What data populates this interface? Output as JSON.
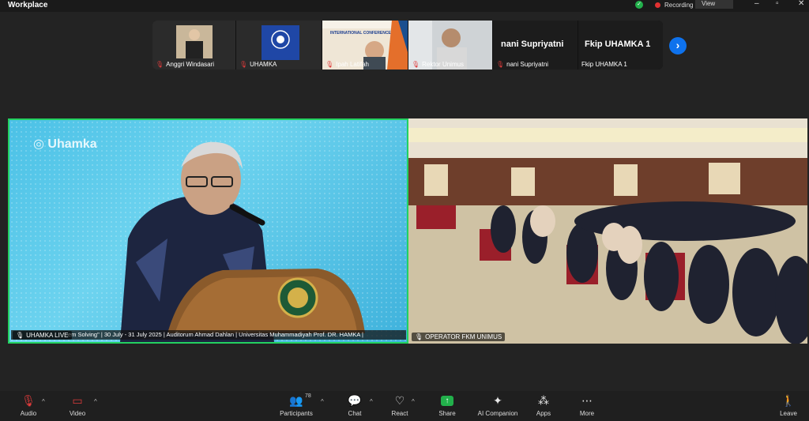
{
  "app": {
    "title": "Workplace"
  },
  "status": {
    "recording_label": "Recording",
    "view_label": "View"
  },
  "thumbnails": [
    {
      "name": "Anggri Windasari"
    },
    {
      "name": "UHAMKA"
    },
    {
      "name": "Ipah Latifah",
      "poster_text": "INTERNATIONAL CONFERENCE"
    },
    {
      "name": "Rektor Unimus"
    },
    {
      "name": "nani Supriyatni",
      "display": "nani Supriyatni"
    },
    {
      "name": "Fkip UHAMKA 1",
      "display": "Fkip UHAMKA 1"
    }
  ],
  "main": {
    "left": {
      "name": "UHAMKA LIVE",
      "brand": "Uhamka",
      "ticker": "em Solving\" | 30 July - 31 July 2025 | Auditorum Ahmad Dahlan | Universitas Muhammadiyah Prof. DR. HAMKA |"
    },
    "right": {
      "name": "OPERATOR FKM UNIMUS"
    }
  },
  "toolbar": {
    "audio": "Audio",
    "video": "Video",
    "participants": "Participants",
    "participants_count": "78",
    "chat": "Chat",
    "react": "React",
    "share": "Share",
    "ai": "AI Companion",
    "apps": "Apps",
    "more": "More",
    "leave": "Leave"
  },
  "colors": {
    "active_speaker": "#23d160",
    "share": "#22b04b",
    "accent": "#0e72ed",
    "muted": "#e03b3b"
  }
}
